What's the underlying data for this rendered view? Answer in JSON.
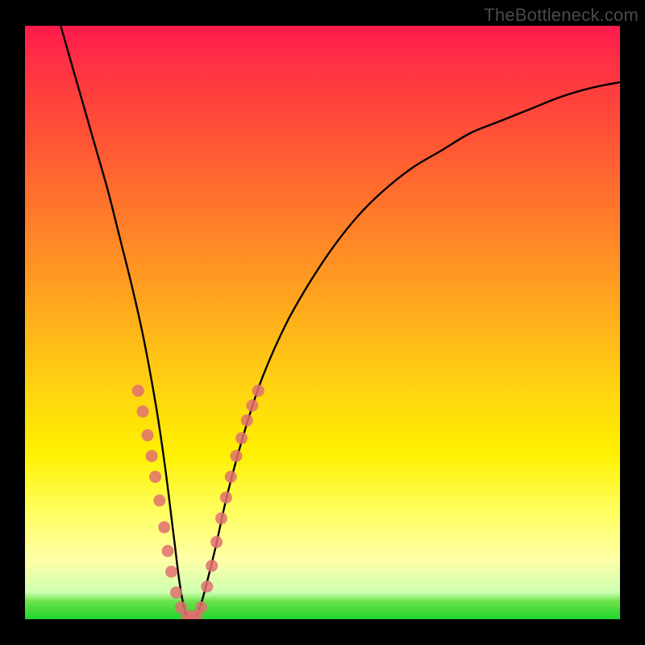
{
  "watermark": "TheBottleneck.com",
  "chart_data": {
    "type": "line",
    "title": "",
    "xlabel": "",
    "ylabel": "",
    "xlim": [
      0,
      100
    ],
    "ylim": [
      0,
      100
    ],
    "series": [
      {
        "name": "bottleneck-curve",
        "x": [
          6,
          8,
          10,
          12,
          14,
          16,
          18,
          20,
          22,
          23.5,
          25,
          26,
          27,
          28,
          29,
          30,
          32,
          34,
          37,
          40,
          44,
          48,
          52,
          56,
          60,
          65,
          70,
          75,
          80,
          85,
          90,
          95,
          100
        ],
        "y": [
          100,
          93,
          86,
          79,
          72,
          64,
          56,
          47,
          36,
          26,
          14,
          6,
          1,
          0.3,
          1,
          4,
          12,
          21,
          32,
          41,
          50,
          57,
          63,
          68,
          72,
          76,
          79,
          82,
          84,
          86,
          88,
          89.5,
          90.5
        ]
      }
    ],
    "markers": {
      "name": "sample-points",
      "points": [
        {
          "x": 19.0,
          "y": 38.5
        },
        {
          "x": 19.8,
          "y": 35.0
        },
        {
          "x": 20.6,
          "y": 31.0
        },
        {
          "x": 21.3,
          "y": 27.5
        },
        {
          "x": 21.9,
          "y": 24.0
        },
        {
          "x": 22.6,
          "y": 20.0
        },
        {
          "x": 23.4,
          "y": 15.5
        },
        {
          "x": 24.0,
          "y": 11.5
        },
        {
          "x": 24.6,
          "y": 8.0
        },
        {
          "x": 25.4,
          "y": 4.5
        },
        {
          "x": 26.2,
          "y": 2.0
        },
        {
          "x": 27.2,
          "y": 0.6
        },
        {
          "x": 28.0,
          "y": 0.3
        },
        {
          "x": 28.8,
          "y": 0.6
        },
        {
          "x": 29.6,
          "y": 2.0
        },
        {
          "x": 30.6,
          "y": 5.5
        },
        {
          "x": 31.4,
          "y": 9.0
        },
        {
          "x": 32.2,
          "y": 13.0
        },
        {
          "x": 33.0,
          "y": 17.0
        },
        {
          "x": 33.8,
          "y": 20.5
        },
        {
          "x": 34.6,
          "y": 24.0
        },
        {
          "x": 35.5,
          "y": 27.5
        },
        {
          "x": 36.4,
          "y": 30.5
        },
        {
          "x": 37.3,
          "y": 33.5
        },
        {
          "x": 38.2,
          "y": 36.0
        },
        {
          "x": 39.2,
          "y": 38.5
        }
      ]
    },
    "gradient_stops": [
      {
        "pos": 0,
        "color": "#ff1a4d"
      },
      {
        "pos": 0.4,
        "color": "#ffa41e"
      },
      {
        "pos": 0.72,
        "color": "#fff000"
      },
      {
        "pos": 0.97,
        "color": "#6be24a"
      },
      {
        "pos": 1.0,
        "color": "#1fd42f"
      }
    ]
  }
}
